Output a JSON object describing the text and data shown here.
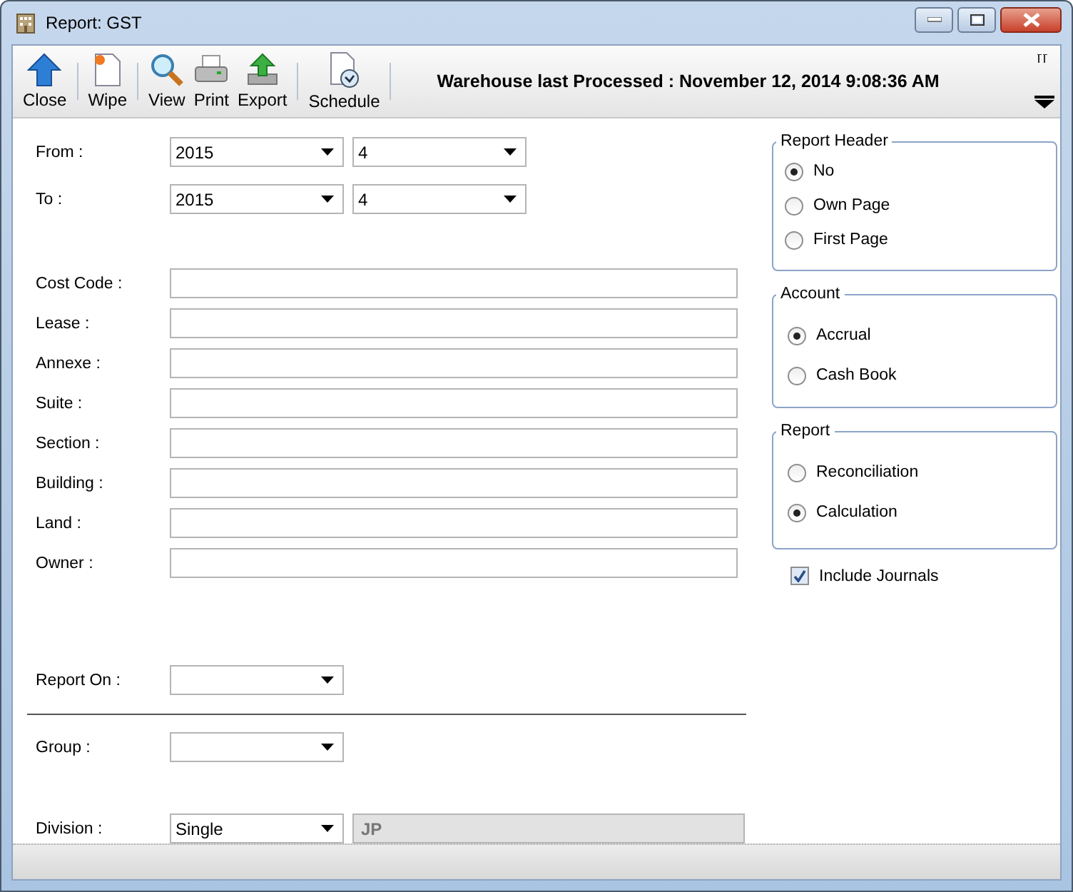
{
  "window": {
    "title": "Report: GST"
  },
  "toolbar": {
    "buttons": [
      {
        "label": "Close",
        "kind": "up"
      },
      {
        "label": "Wipe",
        "kind": "page"
      },
      {
        "label": "View",
        "kind": "magnifier"
      },
      {
        "label": "Print",
        "kind": "printer"
      },
      {
        "label": "Export",
        "kind": "export"
      },
      {
        "label": "Schedule",
        "kind": "schedule"
      }
    ],
    "status": "Warehouse last Processed : November 12, 2014 9:08:36 AM"
  },
  "period": [
    {
      "label": "From :",
      "year": "2015",
      "month": "4"
    },
    {
      "label": "To :",
      "year": "2015",
      "month": "4"
    }
  ],
  "fields": [
    {
      "label": "Cost Code :"
    },
    {
      "label": "Lease :"
    },
    {
      "label": "Annexe :"
    },
    {
      "label": "Suite :"
    },
    {
      "label": "Section :"
    },
    {
      "label": "Building :"
    },
    {
      "label": "Land :"
    },
    {
      "label": "Owner :"
    }
  ],
  "report_on": {
    "label": "Report On :"
  },
  "group": {
    "label": "Group :"
  },
  "division": {
    "label": "Division :",
    "value": "Single",
    "code": "JP",
    "code_disabled": true
  },
  "option_groups": [
    {
      "title": "Report Header",
      "options": [
        {
          "label": "No",
          "selected": true
        },
        {
          "label": "Own Page",
          "selected": false
        },
        {
          "label": "First Page",
          "selected": false
        }
      ]
    },
    {
      "title": "Account",
      "options": [
        {
          "label": "Accrual",
          "selected": true
        },
        {
          "label": "Cash Book",
          "selected": false
        }
      ]
    },
    {
      "title": "Report",
      "options": [
        {
          "label": "Reconciliation",
          "selected": false
        },
        {
          "label": "Calculation",
          "selected": true
        }
      ]
    }
  ],
  "include_journals": {
    "label": "Include Journals",
    "checked": true
  }
}
